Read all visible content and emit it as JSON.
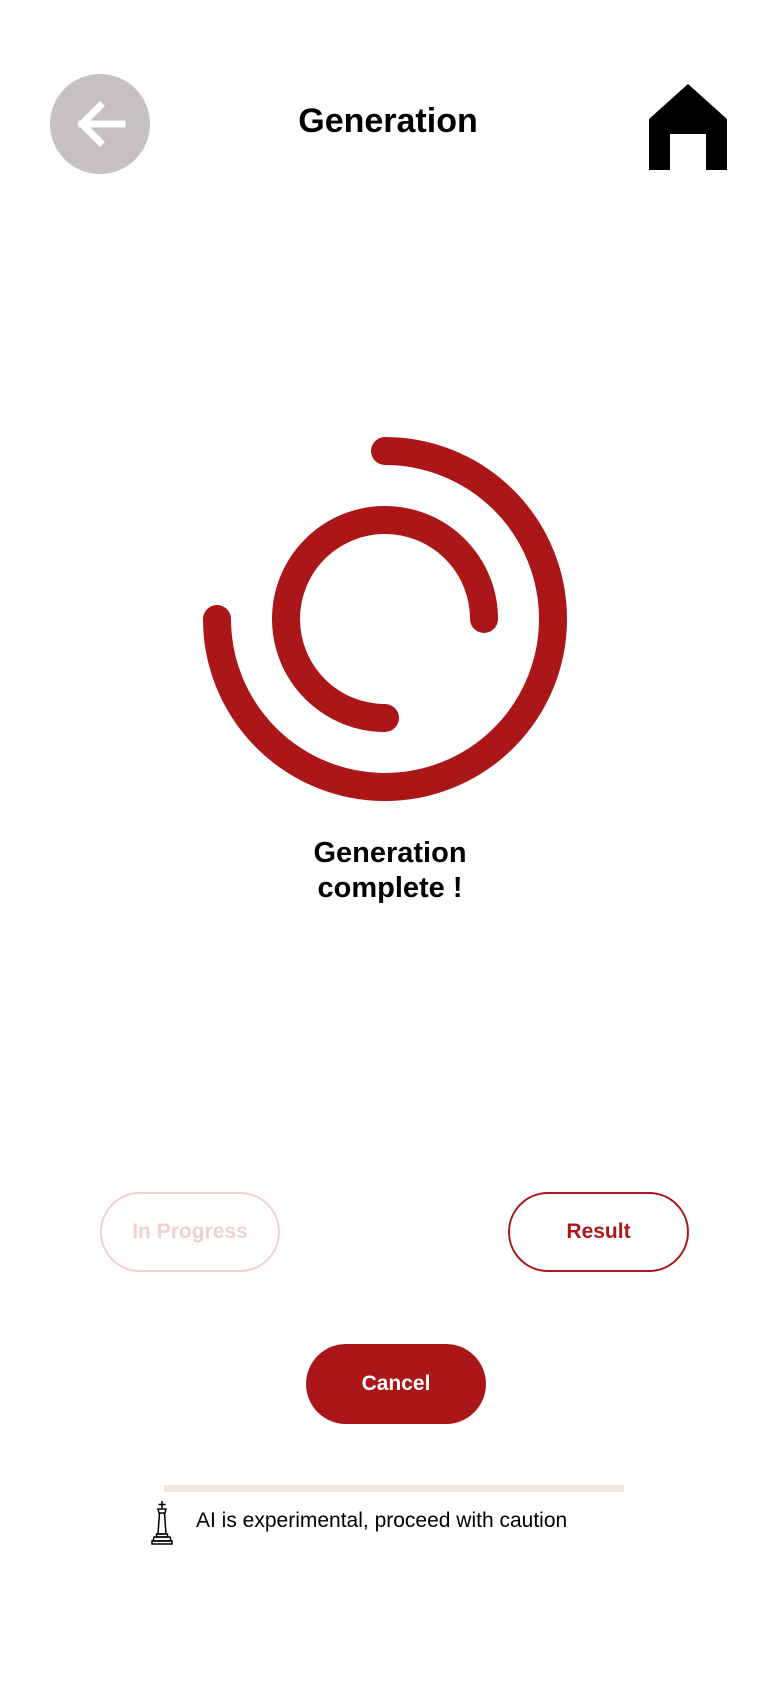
{
  "header": {
    "title": "Generation",
    "back_icon": "arrow-left-icon",
    "home_icon": "home-icon"
  },
  "spinner": {
    "icon": "spinner-icon",
    "color": "#ab1718"
  },
  "status": {
    "line1": "Generation",
    "line2": "complete !"
  },
  "buttons": {
    "in_progress_label": "In Progress",
    "result_label": "Result",
    "cancel_label": "Cancel"
  },
  "footer": {
    "disclaimer": "AI is experimental, proceed with caution",
    "icon": "chess-king-icon"
  },
  "colors": {
    "accent": "#ab1718",
    "accent_faded": "#f1cfd0",
    "back_button_bg": "#c6c0c0",
    "divider": "#f2e6dc"
  }
}
